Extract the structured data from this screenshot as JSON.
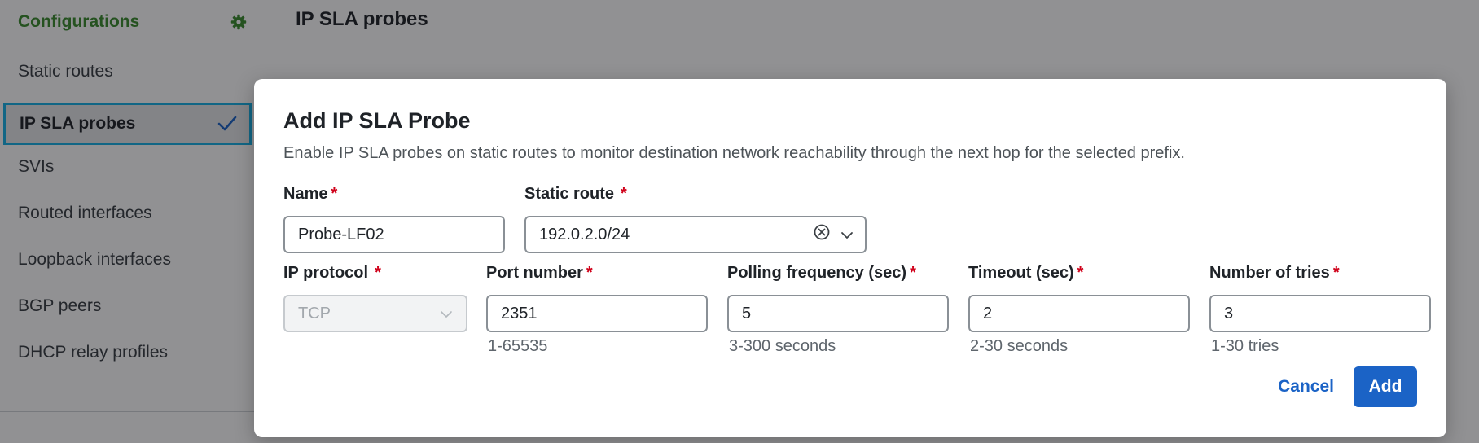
{
  "sidebar": {
    "title": "Configurations",
    "settings_icon": "gear-icon",
    "items": [
      {
        "label": "Static routes"
      },
      {
        "label": "IP SLA probes",
        "selected": true
      },
      {
        "label": "SVIs"
      },
      {
        "label": "Routed interfaces"
      },
      {
        "label": "Loopback interfaces"
      },
      {
        "label": "BGP peers"
      },
      {
        "label": "DHCP relay profiles"
      }
    ]
  },
  "main": {
    "title": "IP SLA probes"
  },
  "modal": {
    "title": "Add IP SLA Probe",
    "description": "Enable IP SLA probes on static routes to monitor destination network reachability through the next hop for the selected prefix.",
    "required_marker": "*",
    "name": {
      "label": "Name",
      "value": "Probe-LF02"
    },
    "static_route": {
      "label": "Static route",
      "value": "192.0.2.0/24"
    },
    "ip_protocol": {
      "label": "IP protocol",
      "value": "TCP",
      "disabled": true
    },
    "port_number": {
      "label": "Port number",
      "value": "2351",
      "help": "1-65535"
    },
    "polling_frequency": {
      "label": "Polling frequency (sec)",
      "value": "5",
      "help": "3-300 seconds"
    },
    "timeout": {
      "label": "Timeout (sec)",
      "value": "2",
      "help": "2-30 seconds"
    },
    "tries": {
      "label": "Number of tries",
      "value": "3",
      "help": "1-30 tries"
    },
    "cancel_label": "Cancel",
    "add_label": "Add"
  },
  "colors": {
    "brand_green": "#3b8c2f",
    "selection_outline": "#17b1e6",
    "primary_blue": "#1b63c6",
    "required_red": "#d0021b"
  }
}
